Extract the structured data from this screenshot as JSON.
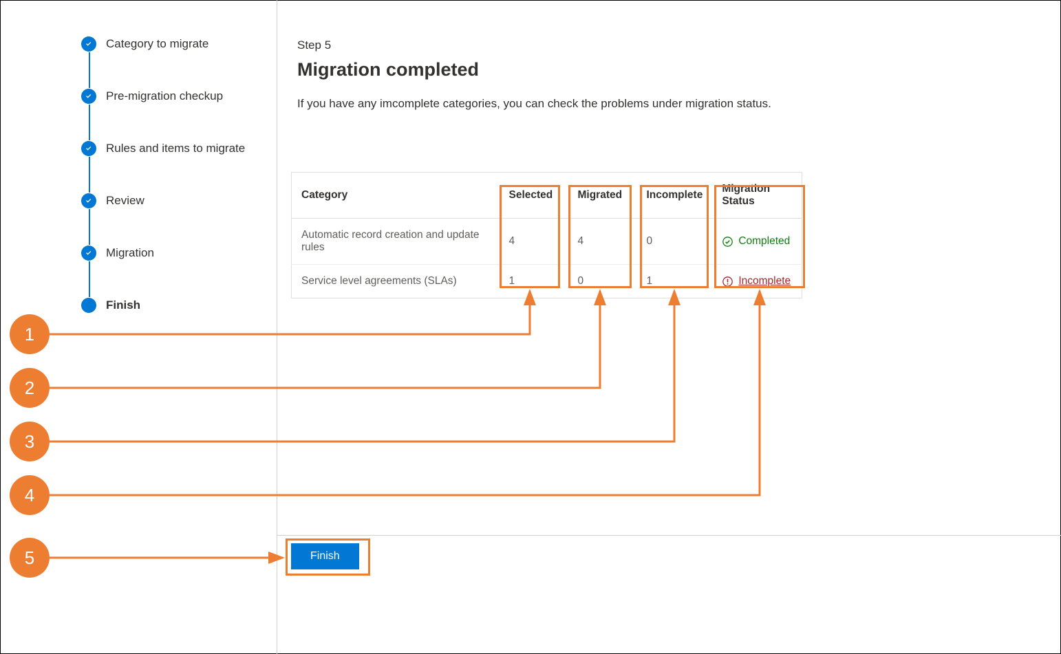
{
  "stepper": {
    "items": [
      {
        "label": "Category to migrate",
        "completed": true
      },
      {
        "label": "Pre-migration checkup",
        "completed": true
      },
      {
        "label": "Rules and items to migrate",
        "completed": true
      },
      {
        "label": "Review",
        "completed": true
      },
      {
        "label": "Migration",
        "completed": true
      },
      {
        "label": "Finish",
        "current": true
      }
    ]
  },
  "main": {
    "step_number": "Step 5",
    "title": "Migration completed",
    "description": "If you have any imcomplete categories, you can check the problems under migration status."
  },
  "table": {
    "headers": {
      "category": "Category",
      "selected": "Selected",
      "migrated": "Migrated",
      "incomplete": "Incomplete",
      "status": "Migration Status"
    },
    "rows": [
      {
        "category": "Automatic record creation and update rules",
        "selected": "4",
        "migrated": "4",
        "incomplete": "0",
        "status_kind": "completed",
        "status_label": "Completed"
      },
      {
        "category": "Service level agreements (SLAs)",
        "selected": "1",
        "migrated": "0",
        "incomplete": "1",
        "status_kind": "incomplete",
        "status_label": "Incomplete"
      }
    ]
  },
  "footer": {
    "finish_label": "Finish"
  },
  "annotations": {
    "labels": {
      "1": "1",
      "2": "2",
      "3": "3",
      "4": "4",
      "5": "5"
    }
  },
  "colors": {
    "brand": "#0078d4",
    "callout": "#ed7d31",
    "success": "#107c10",
    "error": "#a4262c"
  }
}
